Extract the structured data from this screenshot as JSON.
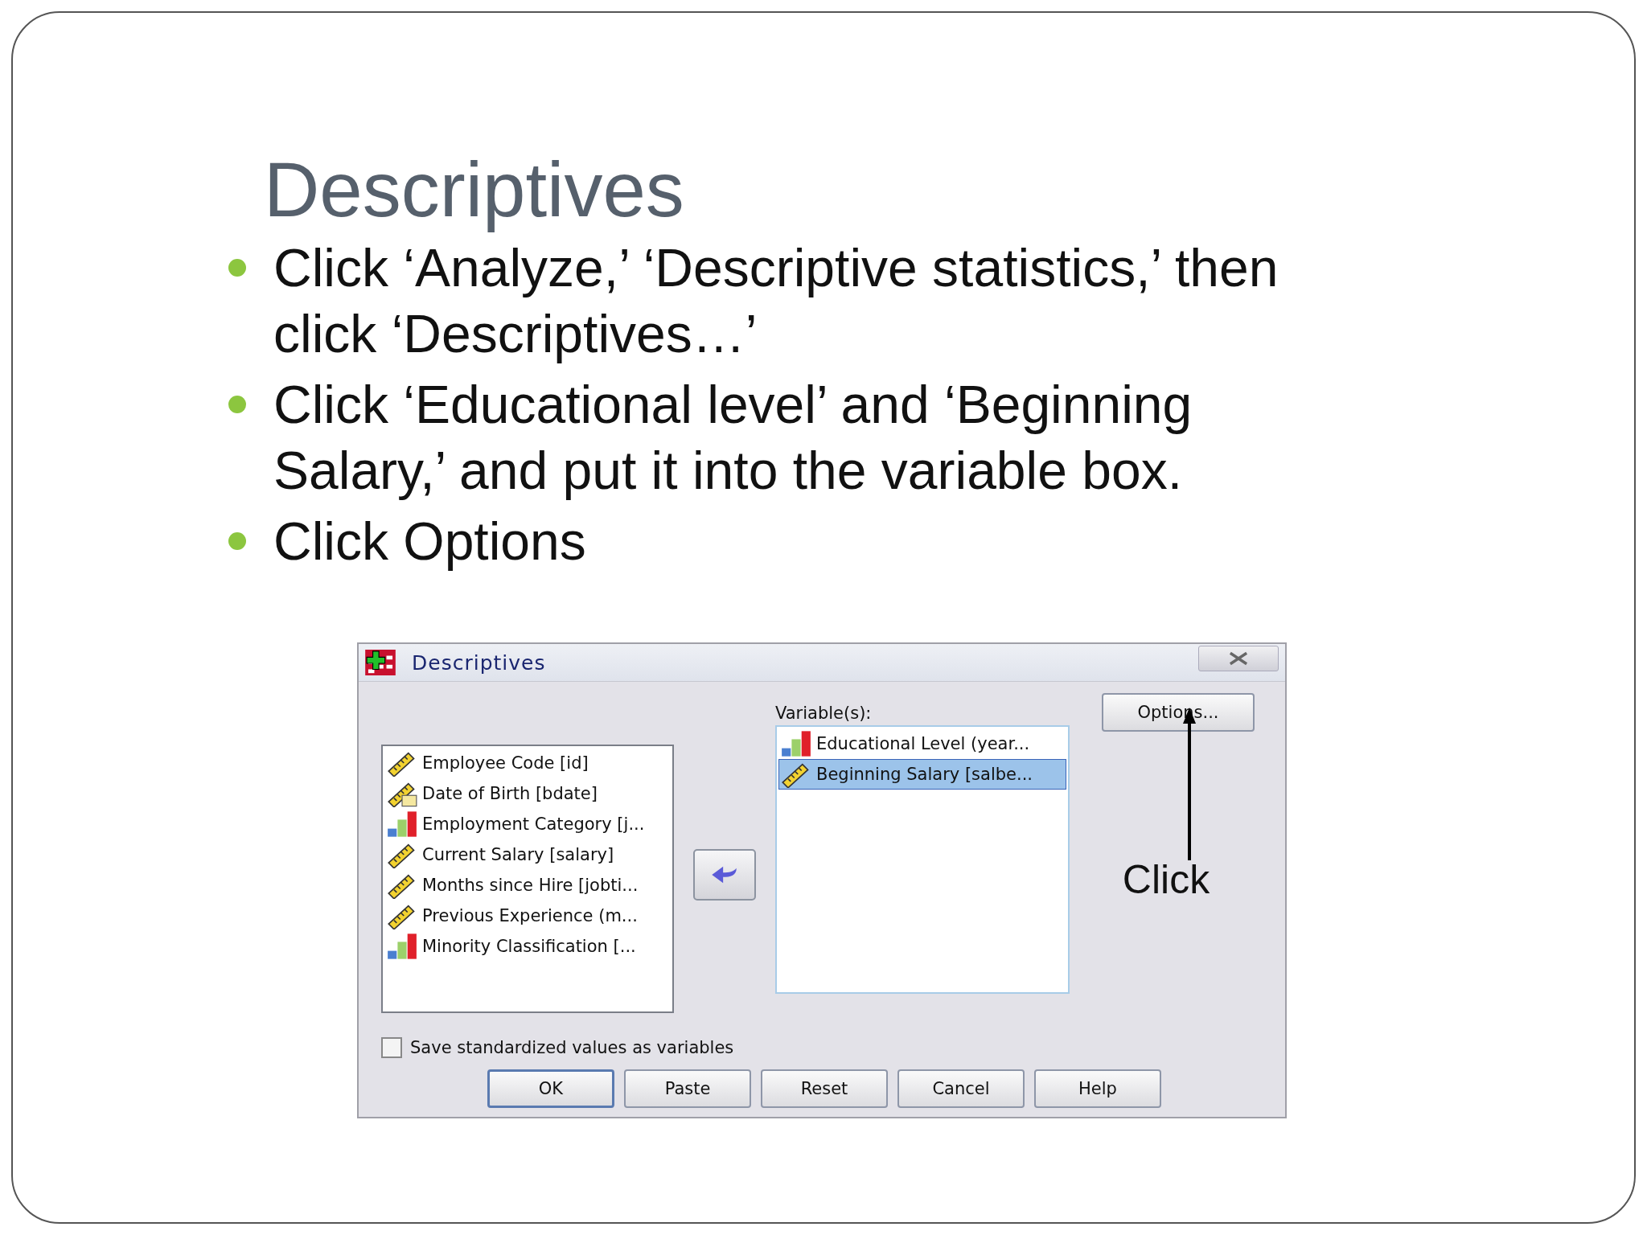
{
  "slide": {
    "title": "Descriptives",
    "bullets": [
      "Click ‘Analyze,’ ‘Descriptive statistics,’ then click ‘Descriptives…’",
      "Click ‘Educational level’ and ‘Beginning Salary,’ and put it into the variable box.",
      "Click Options"
    ]
  },
  "dialog": {
    "title": "Descriptives",
    "source_items": [
      {
        "label": "Employee Code [id]",
        "kind": "scale",
        "selected": false
      },
      {
        "label": "Date of Birth [bdate]",
        "kind": "date",
        "selected": false
      },
      {
        "label": "Employment Category [j...",
        "kind": "ordinal",
        "selected": false
      },
      {
        "label": "Current Salary [salary]",
        "kind": "scale",
        "selected": false
      },
      {
        "label": "Months since Hire [jobti...",
        "kind": "scale",
        "selected": false
      },
      {
        "label": "Previous Experience (m...",
        "kind": "scale",
        "selected": false
      },
      {
        "label": "Minority Classification [...",
        "kind": "ordinal",
        "selected": false
      }
    ],
    "variables_label": "Variable(s):",
    "variables": [
      {
        "label": "Educational Level (year...",
        "kind": "ordinal",
        "selected": false
      },
      {
        "label": "Beginning Salary [salbe...",
        "kind": "scale",
        "selected": true
      }
    ],
    "options_button": "Options...",
    "annotation": "Click",
    "checkbox": {
      "label": "Save standardized values as variables",
      "checked": false
    },
    "buttons": [
      {
        "label": "OK",
        "default": true
      },
      {
        "label": "Paste",
        "default": false
      },
      {
        "label": "Reset",
        "default": false
      },
      {
        "label": "Cancel",
        "default": false
      },
      {
        "label": "Help",
        "default": false
      }
    ]
  }
}
